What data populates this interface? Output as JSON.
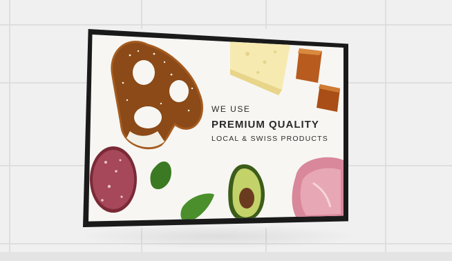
{
  "screen": {
    "headline": {
      "line1": "WE USE",
      "line2": "PREMIUM QUALITY",
      "line3": "LOCAL & SWISS PRODUCTS"
    }
  },
  "icons": {
    "pretzel": "pretzel-icon",
    "cheese": "cheese-icon",
    "bread": "bread-cube-icon",
    "salami": "salami-icon",
    "basil": "basil-leaf-icon",
    "avocado": "avocado-icon",
    "ham": "ham-icon"
  },
  "colors": {
    "wall": "#efefef",
    "bezel": "#1a1a1a",
    "screen_bg": "#f7f6f3",
    "text": "#2a2a2a"
  }
}
